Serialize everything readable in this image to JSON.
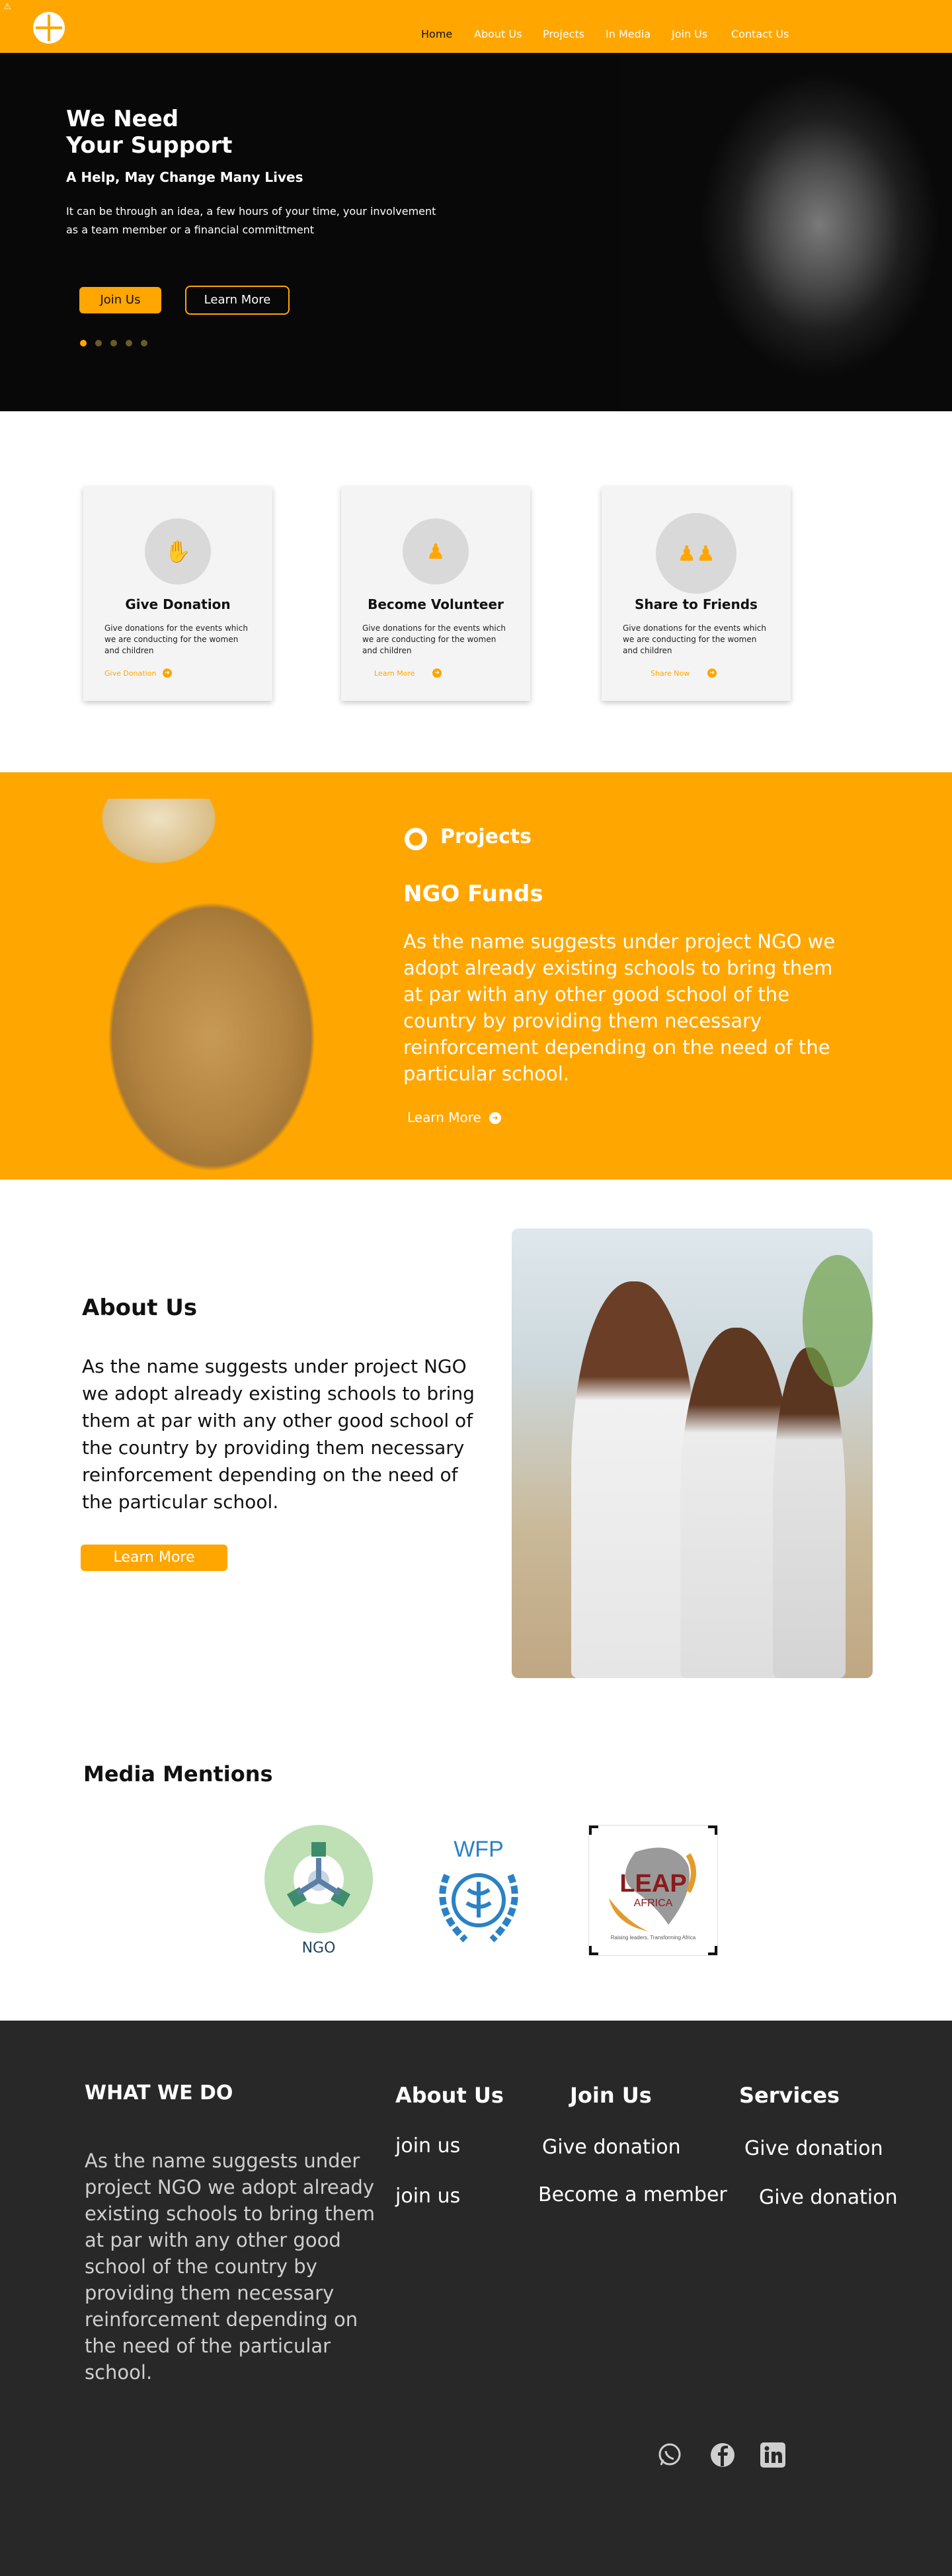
{
  "nav": {
    "items": [
      "Home",
      "About Us",
      "Projects",
      "In Media",
      "Join Us",
      "Contact Us"
    ],
    "active": "Home"
  },
  "hero": {
    "title_line1": "We Need",
    "title_line2": "Your Support",
    "subtitle": "A Help, May Change Many Lives",
    "text_line1": "It can be through an idea, a few hours of your time, your involvement",
    "text_line2": "as a team member or a financial committment",
    "join_label": "Join Us",
    "learn_label": "Learn More",
    "slide_active": 1,
    "slide_count": 5
  },
  "cards": [
    {
      "title": "Give Donation",
      "text": "Give donations for the events which we are conducting for the women and children",
      "link": "Give Donation",
      "icon": "donation-hand-icon"
    },
    {
      "title": "Become Volunteer",
      "text": "Give donations for the events which we are conducting for the women and children",
      "link": "Learn More",
      "icon": "volunteer-group-icon"
    },
    {
      "title": "Share to Friends",
      "text": "Give donations for the events which we are conducting for the women and children",
      "link": "Share Now",
      "icon": "friends-icon"
    }
  ],
  "projects": {
    "label": "Projects",
    "title": "NGO Funds",
    "text": "As the name suggests under project NGO we adopt already existing schools to bring them at par with any other good school of the country by providing them necessary reinforcement depending on the need of the particular school.",
    "learn_label": "Learn More"
  },
  "about": {
    "title": "About Us",
    "text": "As the name suggests under project NGO we adopt already existing schools to bring them at par with any other good school of the country by providing them necessary reinforcement depending on the need of the particular school.",
    "button_label": "Learn More"
  },
  "media": {
    "title": "Media Mentions",
    "logos": [
      {
        "name": "ngo-logo",
        "text": "NGO"
      },
      {
        "name": "wfp-logo",
        "text": "WFP"
      },
      {
        "name": "leap-africa-logo",
        "text_main": "LEAP",
        "text_sub": "AFRICA",
        "tagline": "Raising leaders, Transforming Africa"
      }
    ]
  },
  "footer": {
    "what_we_do_title": "WHAT WE DO",
    "what_we_do_text": "As the name suggests under project NGO we adopt already existing schools to bring them at par with any other good school of the country by providing them necessary reinforcement depending on the need of the particular school.",
    "columns": [
      {
        "title": "About Us",
        "links": [
          "join us",
          "join us"
        ]
      },
      {
        "title": "Join Us",
        "links": [
          "Give donation",
          "Become a member"
        ]
      },
      {
        "title": "Services",
        "links": [
          "Give donation",
          "Give donation"
        ]
      }
    ],
    "social": [
      "whatsapp-icon",
      "facebook-icon",
      "linkedin-icon"
    ]
  },
  "colors": {
    "accent": "#FFA600",
    "dark": "#282828",
    "hero_bg": "#080808"
  }
}
